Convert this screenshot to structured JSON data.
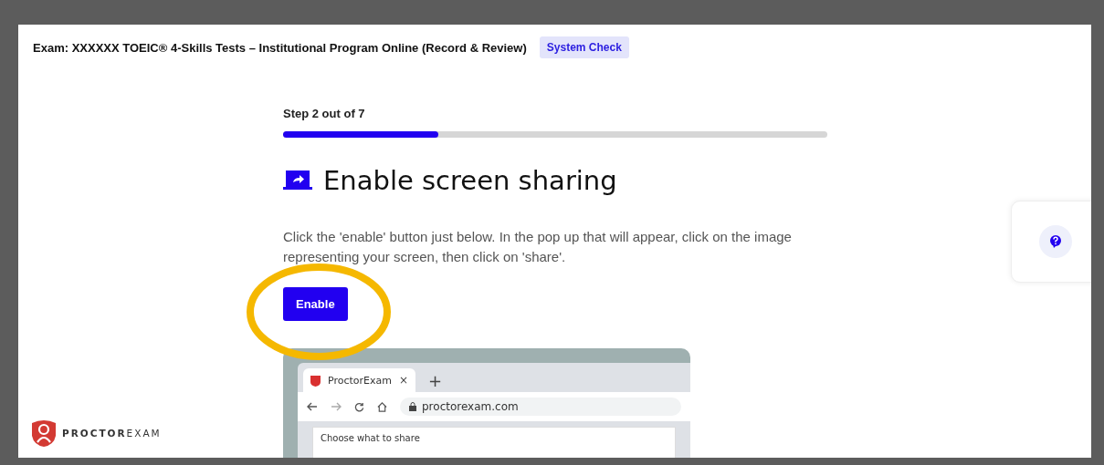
{
  "header": {
    "exam_title": "Exam: XXXXXX TOEIC® 4-Skills Tests – Institutional Program Online (Record & Review)",
    "badge": "System Check"
  },
  "progress": {
    "label": "Step 2 out of 7",
    "level": 0.286
  },
  "step": {
    "title": "Enable screen sharing",
    "instructions": "Click the 'enable' button just below. In the pop up that will appear, click on the image representing your screen, then click on 'share'.",
    "button": "Enable"
  },
  "browser_preview": {
    "tab_title": "ProctorExam",
    "tab_close": "×",
    "new_tab": "+",
    "url": "proctorexam.com",
    "dialog_title": "Choose what to share"
  },
  "brand": {
    "name": "**PROCTOR**EXAM"
  }
}
